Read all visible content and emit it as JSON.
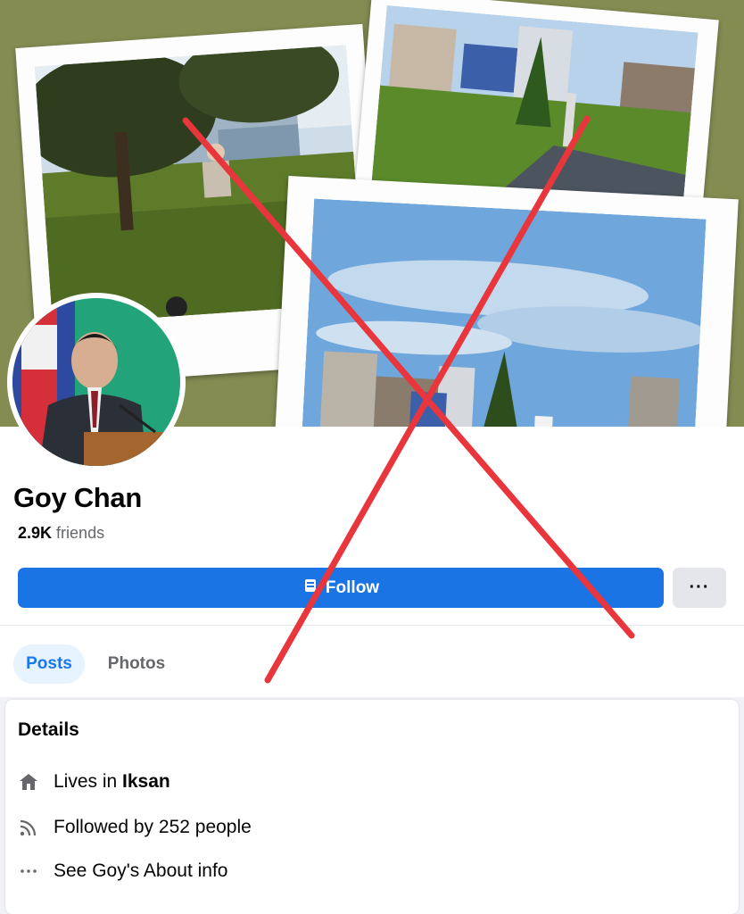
{
  "profile": {
    "name": "Goy Chan",
    "friends_count": "2.9K",
    "friends_label": "friends"
  },
  "actions": {
    "follow_label": "Follow",
    "more_label": "···"
  },
  "tabs": [
    {
      "label": "Posts",
      "active": true
    },
    {
      "label": "Photos",
      "active": false
    }
  ],
  "details": {
    "title": "Details",
    "lives_prefix": "Lives in ",
    "lives_city": "Iksan",
    "followed_by": "Followed by 252 people",
    "about": "See Goy's About info"
  },
  "colors": {
    "cover_bg": "#848c52",
    "follow_blue": "#1b74e4",
    "cross_red": "#e8363c"
  },
  "icons": {
    "follow": "follow-icon",
    "more": "more-dots-icon",
    "home": "home-icon",
    "rss": "rss-followers-icon",
    "dots": "dots-icon"
  }
}
